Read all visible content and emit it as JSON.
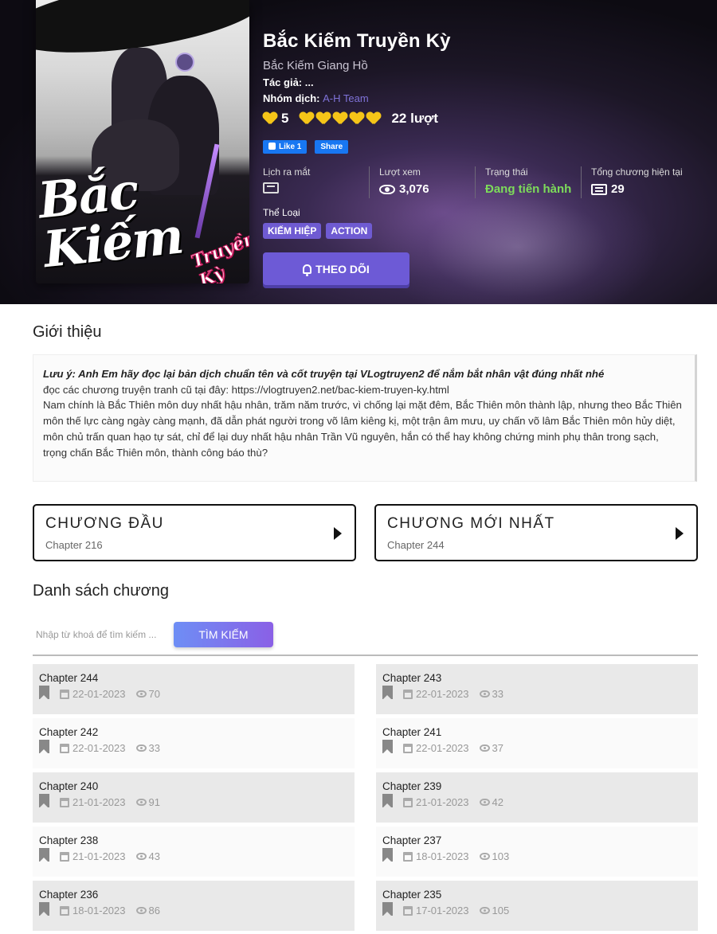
{
  "comic": {
    "title": "Bắc Kiếm Truyền Kỳ",
    "alt_name": "Bắc Kiếm Giang Hồ",
    "author_label": "Tác giả:",
    "author": "...",
    "translator_label": "Nhóm dịch:",
    "translator": "A-H Team",
    "rating_score": "5",
    "rating_hearts": 5,
    "rating_votes": "22 lượt",
    "cover_title": "Bắc Kiếm",
    "cover_subtitle": "Truyền Kỳ"
  },
  "social": {
    "like_label": "Like 1",
    "share_label": "Share"
  },
  "stats": [
    {
      "label": "Lịch ra mắt",
      "value": "",
      "icon": "calendar-icon"
    },
    {
      "label": "Lượt xem",
      "value": "3,076",
      "icon": "eye-icon"
    },
    {
      "label": "Trạng thái",
      "value": "Đang tiến hành",
      "icon": ""
    },
    {
      "label": "Tổng chương hiện tại",
      "value": "29",
      "icon": "list-icon"
    }
  ],
  "genre_label": "Thể Loại",
  "genres": [
    "KIẾM HIỆP",
    "ACTION"
  ],
  "follow_label": "THEO DÕI",
  "intro": {
    "heading": "Giới thiệu",
    "note": "Lưu ý: Anh Em hãy đọc lại bản dịch chuẩn tên và cốt truyện tại VLogtruyen2 để nắm bắt nhân vật đúng nhất nhé",
    "old_link": "đọc các chương truyện tranh cũ tại đây: https://vlogtruyen2.net/bac-kiem-truyen-ky.html",
    "body": "Nam chính là Bắc Thiên môn duy nhất hậu nhân, trăm năm trước, vì chống lại mặt đêm, Bắc Thiên môn thành lập, nhưng theo Bắc Thiên môn thế lực càng ngày càng mạnh, đã dẫn phát người trong võ lâm kiêng kị, một trận âm mưu, uy chấn võ lâm Bắc Thiên môn hủy diệt, môn chủ trấn quan hạo tự sát, chỉ để lại duy nhất hậu nhân Trần Vũ nguyên, hắn có thể hay không chứng minh phụ thân trong sạch, trọng chấn Bắc Thiên môn, thành công báo thù?"
  },
  "nav": {
    "first": {
      "title": "CHƯƠNG ĐẦU",
      "chapter": "Chapter 216"
    },
    "latest": {
      "title": "CHƯƠNG MỚI NHẤT",
      "chapter": "Chapter 244"
    }
  },
  "chapter_list": {
    "heading": "Danh sách chương",
    "search_placeholder": "Nhập từ khoá để tìm kiếm ...",
    "search_button": "TÌM KIẾM",
    "items": [
      {
        "name": "Chapter 244",
        "date": "22-01-2023",
        "views": "70"
      },
      {
        "name": "Chapter 243",
        "date": "22-01-2023",
        "views": "33"
      },
      {
        "name": "Chapter 242",
        "date": "22-01-2023",
        "views": "33"
      },
      {
        "name": "Chapter 241",
        "date": "22-01-2023",
        "views": "37"
      },
      {
        "name": "Chapter 240",
        "date": "21-01-2023",
        "views": "91"
      },
      {
        "name": "Chapter 239",
        "date": "21-01-2023",
        "views": "42"
      },
      {
        "name": "Chapter 238",
        "date": "21-01-2023",
        "views": "43"
      },
      {
        "name": "Chapter 237",
        "date": "18-01-2023",
        "views": "103"
      },
      {
        "name": "Chapter 236",
        "date": "18-01-2023",
        "views": "86"
      },
      {
        "name": "Chapter 235",
        "date": "17-01-2023",
        "views": "105"
      }
    ]
  },
  "colors": {
    "accent": "#6d5ad6",
    "status_green": "#7ddc5a",
    "heart": "#f5c518",
    "link": "#7f72d8"
  }
}
